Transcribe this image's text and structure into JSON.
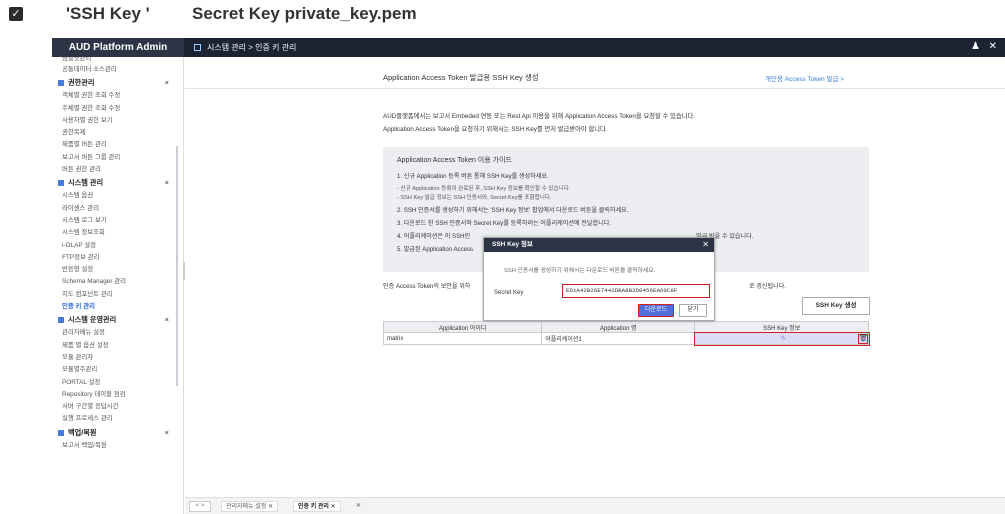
{
  "caption": {
    "part1": "'SSH Key '",
    "part2": "Secret Key private_key.pem"
  },
  "topbar": {
    "brand": "AUD Platform Admin",
    "breadcrumb": "시스템 관리 > 인증 키 관리"
  },
  "sidebar": {
    "top_items": [
      "템플릿관리",
      "공통데이터 소스관리"
    ],
    "groups": [
      {
        "label": "권한관리",
        "items": [
          "객체별 권한 조회 수정",
          "주체별 권한 조회 수정",
          "사용자별 권한 보기",
          "권한복제",
          "제품별 버튼 관리",
          "보고서 버튼 그룹 관리",
          "버튼 권한 관리"
        ]
      },
      {
        "label": "시스템 관리",
        "items": [
          "시스템 옵션",
          "라이센스 관리",
          "시스템 로그 보기",
          "시스템 정보조회",
          "i-OLAP 설정",
          "FTP정보 관리",
          "반응형 설정",
          "Schema Manager 관리",
          "지도 컴포넌트 관리",
          "인증 키 관리"
        ]
      },
      {
        "label": "시스템 운영관리",
        "items": [
          "관리자메뉴 설정",
          "제품 별 옵션 설정",
          "모듈 관리자",
          "모듈별주관리",
          "PORTAL 설정",
          "Repository 테이블 점검",
          "서버 구간별 응답시간",
          "실행 프로세스 관리"
        ]
      },
      {
        "label": "백업/복원",
        "items": [
          "보고서 백업/복원"
        ]
      }
    ]
  },
  "main": {
    "title": "Application Access Token 발급용 SSH Key 생성",
    "personal_link": "개인용 Access Token 발급 >",
    "desc1": "AUD플랫폼에서는 보고서 Embeded 연동 또는 Rest Api 이용을 위해 Application Access Token을 요청할 수 있습니다.",
    "desc2": "Application Access Token을 요청하기 위해서는 SSH Key를 먼저 발급받아야 합니다.",
    "guide_title": "Application Access Token 이용 가이드",
    "guide_steps": [
      "1. 신규 Application 등록 버튼 통해 SSH Key를 생성하세요.",
      "- 신규 Application 등록이 완료된 후, SSH Key 정보를 확인할 수 있습니다.",
      "- SSH Key 발급 정보는 SSH 인증서와, Secret Key를 포함합니다.",
      "2. SSH 인증서를 생성하기 위해서는 'SSH Key 정보' 팝업에서 다운로드 버튼을 클릭하세요.",
      "3. 다운로드 한 SSH 인증서와 Secret Key를 등록하려는 어플리케이션에 전달합니다.",
      "4. 어플리케이션은 이 SSH인",
      "5. 발급된 Application Access"
    ],
    "step4_tail": "발급 받을 수 있습니다.",
    "token_note": "인증 Access Token의 보안을 위하",
    "token_note_tail": "로 갱신됩니다.",
    "gen_button": "SSH Key 생성",
    "table": {
      "headers": [
        "Application 아이디",
        "Application 명",
        "SSH Key 정보"
      ],
      "rows": [
        {
          "id": "matrix",
          "name": "어플리케이션1"
        }
      ]
    }
  },
  "tabbar": {
    "nav": "< >",
    "tabs": [
      "관리자메뉴 설정",
      "인증 키 관리"
    ],
    "close": "✕"
  },
  "modal": {
    "title": "SSH Key 정보",
    "info": "SSH 인증서를 생성하기 위해서는 다운로드 버튼을 클릭하세요.",
    "secret_label": "Secret Key",
    "secret_value": "ED1A42B26E7442DBA8B2D0456EA60C8F",
    "download": "다운로드",
    "close": "닫기"
  }
}
